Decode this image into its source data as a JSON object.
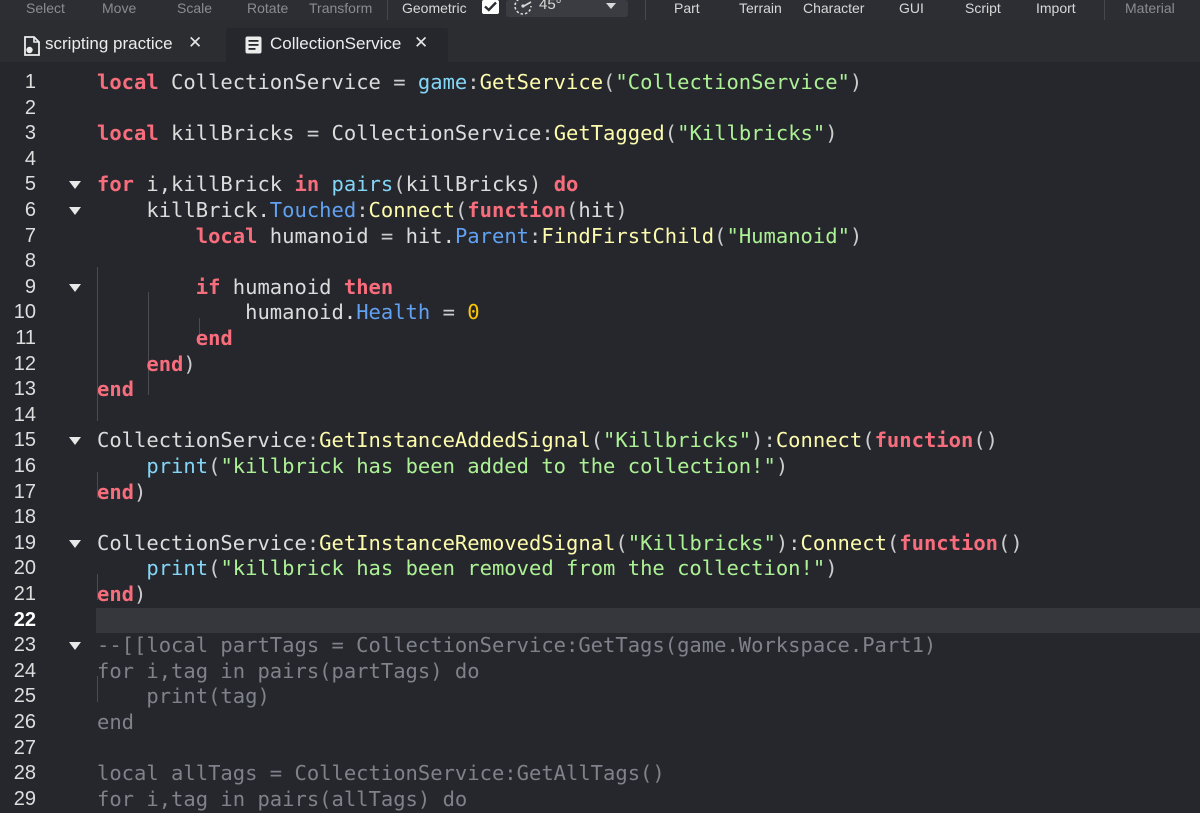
{
  "toolbar": {
    "select": "Select",
    "move": "Move",
    "scale": "Scale",
    "rotate": "Rotate",
    "transform": "Transform",
    "geometric": "Geometric",
    "rotation_step": "45°",
    "part": "Part",
    "terrain": "Terrain",
    "character": "Character",
    "gui": "GUI",
    "script": "Script",
    "import": "Import",
    "material": "Material"
  },
  "tabs": [
    {
      "label": "scripting practice",
      "icon": "script-file-icon",
      "active": false
    },
    {
      "label": "CollectionService",
      "icon": "document-lines-icon",
      "active": true
    }
  ],
  "editor": {
    "current_line": 22,
    "lines": [
      {
        "n": "1",
        "tokens": [
          [
            "kw",
            "local"
          ],
          [
            "t",
            " CollectionService "
          ],
          [
            "op",
            "="
          ],
          [
            "t",
            " "
          ],
          [
            "bi",
            "game"
          ],
          [
            "op",
            ":"
          ],
          [
            "fn",
            "GetService"
          ],
          [
            "op",
            "("
          ],
          [
            "str",
            "\"CollectionService\""
          ],
          [
            "op",
            ")"
          ]
        ]
      },
      {
        "n": "2",
        "tokens": []
      },
      {
        "n": "3",
        "tokens": [
          [
            "kw",
            "local"
          ],
          [
            "t",
            " killBricks "
          ],
          [
            "op",
            "="
          ],
          [
            "t",
            " CollectionService"
          ],
          [
            "op",
            ":"
          ],
          [
            "fn",
            "GetTagged"
          ],
          [
            "op",
            "("
          ],
          [
            "str",
            "\"Killbricks\""
          ],
          [
            "op",
            ")"
          ]
        ]
      },
      {
        "n": "4",
        "tokens": []
      },
      {
        "n": "5",
        "tokens": [
          [
            "kw",
            "for"
          ],
          [
            "t",
            " i,killBrick "
          ],
          [
            "kw",
            "in"
          ],
          [
            "t",
            " "
          ],
          [
            "bi",
            "pairs"
          ],
          [
            "op",
            "("
          ],
          [
            "t",
            "killBricks"
          ],
          [
            "op",
            ")"
          ],
          [
            "t",
            " "
          ],
          [
            "kw",
            "do"
          ]
        ]
      },
      {
        "n": "6",
        "tokens": [
          [
            "t",
            "    killBrick."
          ],
          [
            "prop",
            "Touched"
          ],
          [
            "op",
            ":"
          ],
          [
            "fn",
            "Connect"
          ],
          [
            "op",
            "("
          ],
          [
            "kw",
            "function"
          ],
          [
            "op",
            "("
          ],
          [
            "t",
            "hit"
          ],
          [
            "op",
            ")"
          ]
        ]
      },
      {
        "n": "7",
        "tokens": [
          [
            "t",
            "        "
          ],
          [
            "kw",
            "local"
          ],
          [
            "t",
            " humanoid "
          ],
          [
            "op",
            "="
          ],
          [
            "t",
            " hit."
          ],
          [
            "prop",
            "Parent"
          ],
          [
            "op",
            ":"
          ],
          [
            "fn",
            "FindFirstChild"
          ],
          [
            "op",
            "("
          ],
          [
            "str",
            "\"Humanoid\""
          ],
          [
            "op",
            ")"
          ]
        ]
      },
      {
        "n": "8",
        "tokens": []
      },
      {
        "n": "9",
        "tokens": [
          [
            "t",
            "        "
          ],
          [
            "kw",
            "if"
          ],
          [
            "t",
            " humanoid "
          ],
          [
            "kw",
            "then"
          ]
        ]
      },
      {
        "n": "10",
        "tokens": [
          [
            "t",
            "            humanoid."
          ],
          [
            "prop",
            "Health"
          ],
          [
            "t",
            " "
          ],
          [
            "op",
            "="
          ],
          [
            "t",
            " "
          ],
          [
            "num",
            "0"
          ]
        ]
      },
      {
        "n": "11",
        "tokens": [
          [
            "t",
            "        "
          ],
          [
            "kw",
            "end"
          ]
        ]
      },
      {
        "n": "12",
        "tokens": [
          [
            "t",
            "    "
          ],
          [
            "kw",
            "end"
          ],
          [
            "op",
            ")"
          ]
        ]
      },
      {
        "n": "13",
        "tokens": [
          [
            "kw",
            "end"
          ]
        ]
      },
      {
        "n": "14",
        "tokens": []
      },
      {
        "n": "15",
        "tokens": [
          [
            "t",
            "CollectionService"
          ],
          [
            "op",
            ":"
          ],
          [
            "fn",
            "GetInstanceAddedSignal"
          ],
          [
            "op",
            "("
          ],
          [
            "str",
            "\"Killbricks\""
          ],
          [
            "op",
            "):"
          ],
          [
            "fn",
            "Connect"
          ],
          [
            "op",
            "("
          ],
          [
            "kw",
            "function"
          ],
          [
            "op",
            "()"
          ]
        ]
      },
      {
        "n": "16",
        "tokens": [
          [
            "t",
            "    "
          ],
          [
            "bi",
            "print"
          ],
          [
            "op",
            "("
          ],
          [
            "str",
            "\"killbrick has been added to the collection!\""
          ],
          [
            "op",
            ")"
          ]
        ]
      },
      {
        "n": "17",
        "tokens": [
          [
            "kw",
            "end"
          ],
          [
            "op",
            ")"
          ]
        ]
      },
      {
        "n": "18",
        "tokens": []
      },
      {
        "n": "19",
        "tokens": [
          [
            "t",
            "CollectionService"
          ],
          [
            "op",
            ":"
          ],
          [
            "fn",
            "GetInstanceRemovedSignal"
          ],
          [
            "op",
            "("
          ],
          [
            "str",
            "\"Killbricks\""
          ],
          [
            "op",
            "):"
          ],
          [
            "fn",
            "Connect"
          ],
          [
            "op",
            "("
          ],
          [
            "kw",
            "function"
          ],
          [
            "op",
            "()"
          ]
        ]
      },
      {
        "n": "20",
        "tokens": [
          [
            "t",
            "    "
          ],
          [
            "bi",
            "print"
          ],
          [
            "op",
            "("
          ],
          [
            "str",
            "\"killbrick has been removed from the collection!\""
          ],
          [
            "op",
            ")"
          ]
        ]
      },
      {
        "n": "21",
        "tokens": [
          [
            "kw",
            "end"
          ],
          [
            "op",
            ")"
          ]
        ]
      },
      {
        "n": "22",
        "tokens": []
      },
      {
        "n": "23",
        "tokens": [
          [
            "cm",
            "--[[local partTags = CollectionService:GetTags(game.Workspace.Part1)"
          ]
        ]
      },
      {
        "n": "24",
        "tokens": [
          [
            "cm",
            "for i,tag in pairs(partTags) do"
          ]
        ]
      },
      {
        "n": "25",
        "tokens": [
          [
            "cm",
            "    print(tag)"
          ]
        ]
      },
      {
        "n": "26",
        "tokens": [
          [
            "cm",
            "end"
          ]
        ]
      },
      {
        "n": "27",
        "tokens": []
      },
      {
        "n": "28",
        "tokens": [
          [
            "cm",
            "local allTags = CollectionService:GetAllTags()"
          ]
        ]
      },
      {
        "n": "29",
        "tokens": [
          [
            "cm",
            "for i,tag in pairs(allTags) do"
          ]
        ]
      }
    ]
  },
  "colors": {
    "keyword": "#f86d7c",
    "function": "#fdfbac",
    "property": "#61a1f1",
    "string": "#adf195",
    "number": "#ffc600",
    "builtin": "#84d6f7",
    "comment": "#7f828a"
  }
}
